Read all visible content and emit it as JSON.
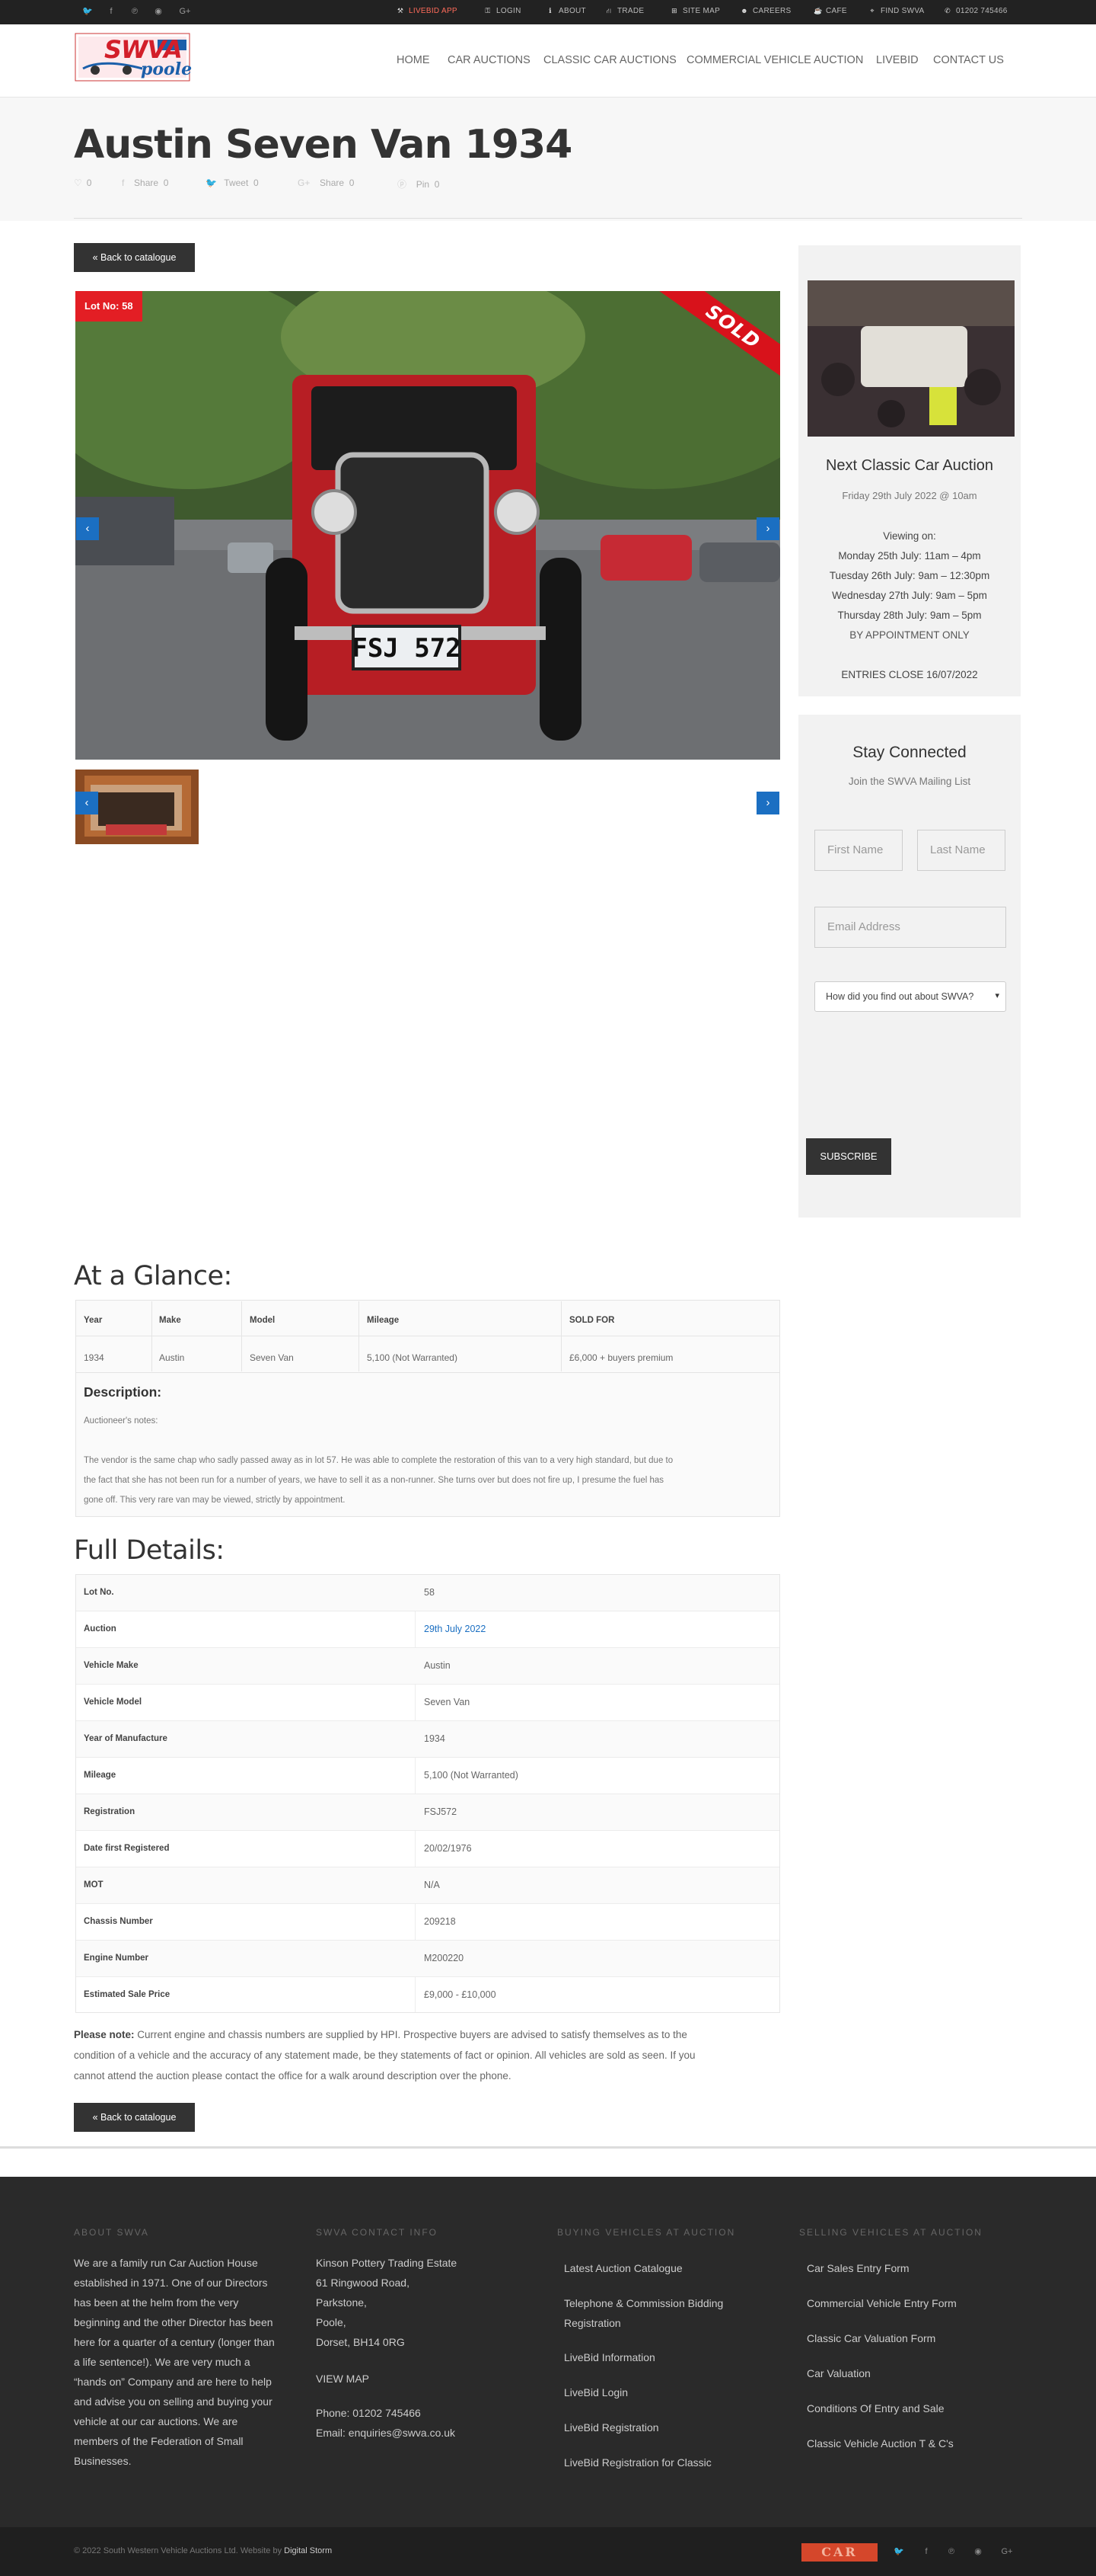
{
  "topbar": {
    "social_icons": [
      "twitter-icon",
      "facebook-icon",
      "pinterest-icon",
      "rss-icon",
      "googleplus-icon"
    ],
    "links": [
      {
        "label": "LIVEBID APP",
        "color": "#ff6b5a"
      },
      {
        "label": "LOGIN"
      },
      {
        "label": "ABOUT"
      },
      {
        "label": "TRADE"
      },
      {
        "label": "SITE MAP"
      },
      {
        "label": "CAREERS"
      },
      {
        "label": "CAFE"
      },
      {
        "label": "FIND SWVA"
      },
      {
        "label": "01202 745466"
      }
    ]
  },
  "logo": {
    "text": "SWVA",
    "sub": "poole"
  },
  "nav": [
    "HOME",
    "CAR AUCTIONS",
    "CLASSIC CAR AUCTIONS",
    "COMMERCIAL VEHICLE AUCTION",
    "LIVEBID",
    "CONTACT US"
  ],
  "page": {
    "title": "Austin Seven Van 1934",
    "shares": [
      {
        "label": "",
        "count": "0",
        "icon": "heart-icon"
      },
      {
        "label": "Share",
        "count": "0",
        "icon": "facebook-icon"
      },
      {
        "label": "Tweet",
        "count": "0",
        "icon": "twitter-icon"
      },
      {
        "label": "Share",
        "count": "0",
        "icon": "googleplus-icon"
      },
      {
        "label": "Pin",
        "count": "0",
        "icon": "pinterest-icon"
      }
    ],
    "back_label": "« Back to catalogue"
  },
  "gallery": {
    "lot_label": "Lot No: 58",
    "sold_label": "SOLD",
    "plate": "FSJ 572"
  },
  "sidebar": {
    "auction_title": "Next Classic Car Auction",
    "auction_date": "Friday 29th July 2022 @ 10am",
    "viewing_title": "Viewing on:",
    "viewing": [
      "Monday 25th July: 11am – 4pm",
      "Tuesday 26th July: 9am – 12:30pm",
      "Wednesday 27th July: 9am – 5pm",
      "Thursday 28th July: 9am – 5pm"
    ],
    "appointment": "BY APPOINTMENT ONLY",
    "entries_close": "ENTRIES CLOSE 16/07/2022",
    "stay_title": "Stay Connected",
    "stay_sub": "Join the SWVA Mailing List",
    "first_name_ph": "First Name",
    "last_name_ph": "Last Name",
    "email_ph": "Email Address",
    "select_value": "How did you find out about SWVA?",
    "subscribe_label": "SUBSCRIBE"
  },
  "glance": {
    "title": "At a Glance:",
    "headers": [
      "Year",
      "Make",
      "Model",
      "Mileage",
      "SOLD FOR"
    ],
    "values": [
      "1934",
      "Austin",
      "Seven Van",
      "5,100 (Not Warranted)",
      "£6,000 + buyers premium"
    ],
    "desc_title": "Description:",
    "notes_label": "Auctioneer's notes:",
    "desc_lines": [
      "The vendor is the same chap who sadly passed away as in lot 57.  He was able to complete the restoration of this van to a very high standard, but due to",
      "the fact that she has not been run for a number of years, we have to sell it as a non-runner.  She turns over but does not fire up, I presume the fuel has",
      "gone off.  This very rare van may be viewed, strictly by appointment."
    ]
  },
  "full": {
    "title": "Full Details:",
    "rows": [
      {
        "k": "Lot No.",
        "v": "58"
      },
      {
        "k": "Auction",
        "v": "29th July 2022",
        "link": true
      },
      {
        "k": "Vehicle Make",
        "v": "Austin"
      },
      {
        "k": "Vehicle Model",
        "v": "Seven Van"
      },
      {
        "k": "Year of Manufacture",
        "v": "1934"
      },
      {
        "k": "Mileage",
        "v": "5,100 (Not Warranted)"
      },
      {
        "k": "Registration",
        "v": "FSJ572"
      },
      {
        "k": "Date first Registered",
        "v": "20/02/1976"
      },
      {
        "k": "MOT",
        "v": "N/A"
      },
      {
        "k": "Chassis Number",
        "v": "209218"
      },
      {
        "k": "Engine Number",
        "v": "M200220"
      },
      {
        "k": "Estimated Sale Price",
        "v": "£9,000 - £10,000"
      }
    ],
    "note_label": "Please note:",
    "note_lines": [
      " Current engine and chassis numbers are supplied by HPI. Prospective buyers are advised to satisfy themselves as to the",
      "condition of a vehicle and the accuracy of any statement made, be they statements of fact or opinion. All vehicles are sold as seen. If you",
      "cannot attend the auction please contact the office for a walk around description over the phone."
    ]
  },
  "footer": {
    "about_title": "ABOUT SWVA",
    "about_lines": [
      "We are a family run Car Auction House",
      "established in 1971. One of our Directors",
      "has been at the helm from the very",
      "beginning and the other Director has been",
      "here for a quarter of a century (longer than",
      "a life sentence!). We are very much a",
      "“hands on” Company and are here to help",
      "and advise you on selling and buying your",
      "vehicle at our car auctions. We are",
      "members of the Federation of Small",
      "Businesses."
    ],
    "contact_title": "SWVA CONTACT INFO",
    "address": [
      "Kinson Pottery Trading Estate",
      "61 Ringwood Road,",
      "Parkstone,",
      "Poole,",
      "Dorset, BH14 0RG"
    ],
    "view_map": "VIEW MAP",
    "phone": "Phone: 01202 745466",
    "email": "Email: enquiries@swva.co.uk",
    "buying_title": "BUYING VEHICLES AT AUCTION",
    "buying_links": [
      "Latest Auction Catalogue",
      "Telephone & Commission Bidding",
      "Registration",
      "LiveBid Information",
      "LiveBid Login",
      "LiveBid Registration",
      "LiveBid Registration for Classic"
    ],
    "selling_title": "SELLING VEHICLES AT AUCTION",
    "selling_links": [
      "Car Sales Entry Form",
      "Commercial Vehicle Entry Form",
      "Classic Car Valuation Form",
      "Car Valuation",
      "Conditions Of Entry and Sale",
      "Classic Vehicle Auction T & C's"
    ],
    "copyright": "© 2022 South Western Vehicle Auctions Ltd. Website by",
    "designer": "Digital Storm",
    "badge": "CAR"
  },
  "colors": {
    "accent": "#1b6fc2",
    "sold": "#d8121b",
    "lot": "#e31e24",
    "dark": "#333333",
    "footer": "#2a2a2a"
  }
}
